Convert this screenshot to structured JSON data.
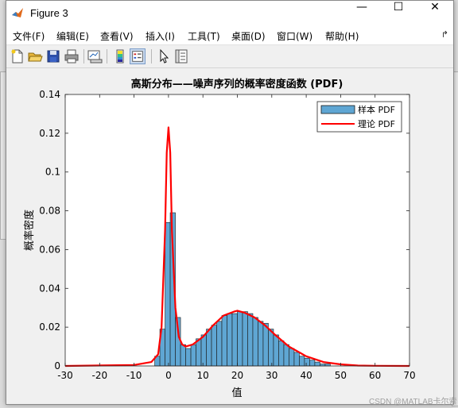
{
  "window": {
    "title": "Figure 3"
  },
  "menu": [
    {
      "label": "文件(F)"
    },
    {
      "label": "编辑(E)"
    },
    {
      "label": "查看(V)"
    },
    {
      "label": "插入(I)"
    },
    {
      "label": "工具(T)"
    },
    {
      "label": "桌面(D)"
    },
    {
      "label": "窗口(W)"
    },
    {
      "label": "帮助(H)"
    }
  ],
  "toolbar": [
    "new-figure-icon",
    "open-icon",
    "save-icon",
    "print-icon",
    "link-plot-icon",
    "colorbar-icon",
    "legend-icon",
    "pointer-icon",
    "property-editor-icon"
  ],
  "watermark": "CSDN @MATLAB卡尔索",
  "colors": {
    "bar_fill": "#5fa6d3",
    "bar_edge": "#1a1a1a",
    "line": "#ff0000"
  },
  "chart_data": {
    "type": "bar",
    "title": "高斯分布——噪声序列的概率密度函数 (PDF)",
    "xlabel": "值",
    "ylabel": "概率密度",
    "xlim": [
      -30,
      70
    ],
    "ylim": [
      0,
      0.14
    ],
    "xticks": [
      "-30",
      "-20",
      "-10",
      "0",
      "10",
      "20",
      "30",
      "40",
      "50",
      "60",
      "70"
    ],
    "yticks": [
      "0",
      "0.02",
      "0.04",
      "0.06",
      "0.08",
      "0.1",
      "0.12",
      "0.14"
    ],
    "legend": {
      "position": "top-right",
      "entries": [
        "样本 PDF",
        "理论 PDF"
      ]
    },
    "series": [
      {
        "name": "样本 PDF",
        "kind": "histogram",
        "bin_width": 1.5,
        "bin_starts": [
          -4,
          -2.5,
          -1,
          0.5,
          2,
          3.5,
          5,
          6.5,
          8,
          9.5,
          11,
          12.5,
          14,
          15.5,
          17,
          18.5,
          20,
          21.5,
          23,
          24.5,
          26,
          27.5,
          29,
          30.5,
          32,
          33.5,
          35,
          36.5,
          38,
          39.5,
          41,
          42.5,
          44,
          45.5
        ],
        "values": [
          0.005,
          0.019,
          0.074,
          0.079,
          0.025,
          0.011,
          0.009,
          0.011,
          0.014,
          0.016,
          0.019,
          0.021,
          0.023,
          0.026,
          0.027,
          0.027,
          0.028,
          0.028,
          0.027,
          0.025,
          0.023,
          0.022,
          0.019,
          0.016,
          0.013,
          0.011,
          0.009,
          0.007,
          0.005,
          0.004,
          0.003,
          0.002,
          0.001,
          0.001
        ]
      },
      {
        "name": "理论 PDF",
        "kind": "line",
        "x": [
          -30,
          -10,
          -5,
          -3,
          -2,
          -1,
          -0.5,
          0,
          0.5,
          1,
          2,
          3,
          4,
          5,
          7,
          10,
          13,
          16,
          19,
          20,
          22,
          25,
          28,
          31,
          35,
          40,
          45,
          50,
          55,
          60,
          70
        ],
        "y": [
          0,
          0.0005,
          0.002,
          0.006,
          0.02,
          0.07,
          0.11,
          0.123,
          0.11,
          0.07,
          0.03,
          0.015,
          0.011,
          0.01,
          0.011,
          0.015,
          0.021,
          0.026,
          0.028,
          0.0285,
          0.0275,
          0.025,
          0.021,
          0.016,
          0.01,
          0.005,
          0.002,
          0.0008,
          0.0002,
          0.0001,
          0
        ]
      }
    ],
    "grid": false
  }
}
